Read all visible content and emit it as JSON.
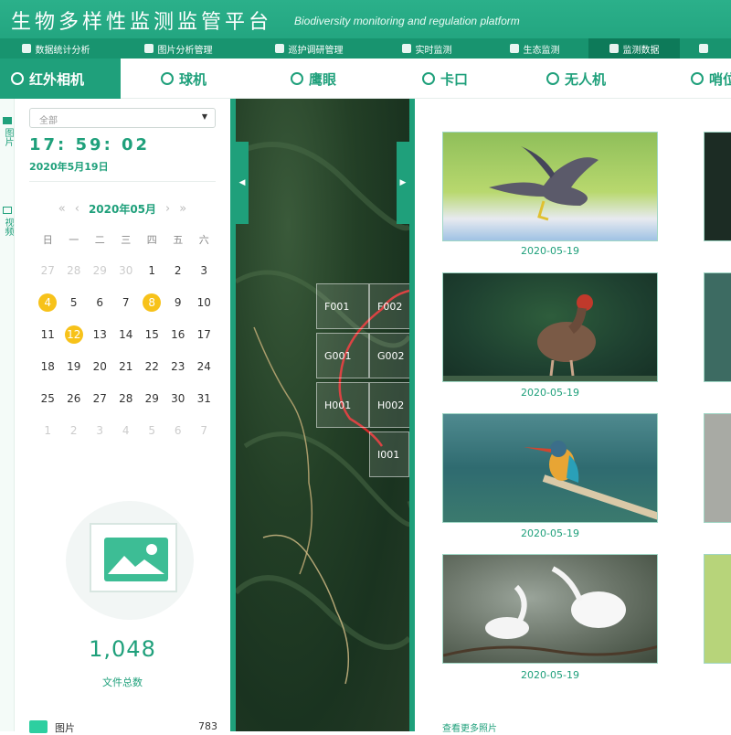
{
  "header": {
    "title": "生物多样性监测监管平台",
    "subtitle": "Biodiversity monitoring and regulation platform"
  },
  "nav": {
    "items": [
      {
        "label": "数据统计分析"
      },
      {
        "label": "图片分析管理"
      },
      {
        "label": "巡护调研管理"
      },
      {
        "label": "实时监测"
      },
      {
        "label": "生态监测"
      },
      {
        "label": "监测数据",
        "active": true
      }
    ]
  },
  "subtabs": [
    {
      "label": "红外相机",
      "icon": "camera-signal-icon",
      "active": true
    },
    {
      "label": "球机",
      "icon": "dome-camera-icon"
    },
    {
      "label": "鹰眼",
      "icon": "eagle-eye-icon"
    },
    {
      "label": "卡口",
      "icon": "checkpoint-icon"
    },
    {
      "label": "无人机",
      "icon": "drone-icon"
    },
    {
      "label": "哨位",
      "icon": "sentry-icon"
    }
  ],
  "left_strip": {
    "pictures_label": "图片",
    "video_label": "视频"
  },
  "filter": {
    "selected": "全部"
  },
  "clock": {
    "time": "17: 59: 02",
    "date": "2020年5月19日"
  },
  "calendar": {
    "month_label": "2020年05月",
    "weekdays": [
      "日",
      "一",
      "二",
      "三",
      "四",
      "五",
      "六"
    ],
    "days": [
      {
        "d": "27",
        "muted": true
      },
      {
        "d": "28",
        "muted": true
      },
      {
        "d": "29",
        "muted": true
      },
      {
        "d": "30",
        "muted": true
      },
      {
        "d": "1"
      },
      {
        "d": "2"
      },
      {
        "d": "3"
      },
      {
        "d": "4",
        "marked": true
      },
      {
        "d": "5"
      },
      {
        "d": "6"
      },
      {
        "d": "7"
      },
      {
        "d": "8",
        "marked": true
      },
      {
        "d": "9"
      },
      {
        "d": "10"
      },
      {
        "d": "11"
      },
      {
        "d": "12",
        "marked": true
      },
      {
        "d": "13"
      },
      {
        "d": "14"
      },
      {
        "d": "15"
      },
      {
        "d": "16"
      },
      {
        "d": "17"
      },
      {
        "d": "18"
      },
      {
        "d": "19"
      },
      {
        "d": "20"
      },
      {
        "d": "21"
      },
      {
        "d": "22"
      },
      {
        "d": "23"
      },
      {
        "d": "24"
      },
      {
        "d": "25"
      },
      {
        "d": "26"
      },
      {
        "d": "27"
      },
      {
        "d": "28"
      },
      {
        "d": "29"
      },
      {
        "d": "30"
      },
      {
        "d": "31"
      },
      {
        "d": "1",
        "muted": true
      },
      {
        "d": "2",
        "muted": true
      },
      {
        "d": "3",
        "muted": true
      },
      {
        "d": "4",
        "muted": true
      },
      {
        "d": "5",
        "muted": true
      },
      {
        "d": "6",
        "muted": true
      },
      {
        "d": "7",
        "muted": true
      }
    ]
  },
  "files": {
    "total": "1,048",
    "total_label": "文件总数",
    "legend": [
      {
        "name": "图片",
        "value": "783",
        "color": "#2dcfa0"
      }
    ]
  },
  "map": {
    "grid_cells": [
      "F001",
      "F002",
      "G001",
      "G002",
      "H001",
      "H002",
      "I001"
    ]
  },
  "gallery": {
    "items": [
      {
        "date": "2020-05-19",
        "subject": "hawk in flight"
      },
      {
        "date": "2020-05-19",
        "subject": "pheasant on branch"
      },
      {
        "date": "2020-05-19",
        "subject": "kingfisher on branch"
      },
      {
        "date": "2020-05-19",
        "subject": "egrets nesting"
      }
    ],
    "more_label": "查看更多照片"
  },
  "colors": {
    "brand": "#1fa07b",
    "accent_marker": "#f7c21a",
    "boundary": "#d62a2a"
  }
}
